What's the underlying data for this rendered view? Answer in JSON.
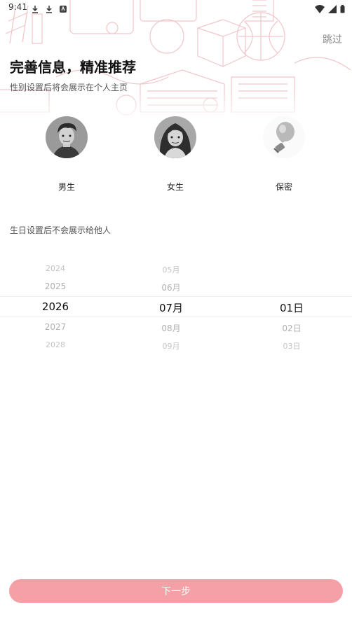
{
  "status_bar": {
    "time": "9:41"
  },
  "header": {
    "skip_label": "跳过",
    "title": "完善信息，精准推荐",
    "subtitle": "性别设置后将会展示在个人主页"
  },
  "gender": {
    "options": [
      {
        "label": "男生",
        "icon": "male-avatar"
      },
      {
        "label": "女生",
        "icon": "female-avatar"
      },
      {
        "label": "保密",
        "icon": "lightbulb-icon"
      }
    ]
  },
  "birthday": {
    "hint": "生日设置后不会展示给他人",
    "years": [
      "2024",
      "2025",
      "2026",
      "2027",
      "2028"
    ],
    "months": [
      "05月",
      "06月",
      "07月",
      "08月",
      "09月"
    ],
    "days": [
      "",
      "",
      "01日",
      "02日",
      "03日"
    ],
    "selected": {
      "year": "2026",
      "month": "07月",
      "day": "01日"
    }
  },
  "footer": {
    "next_label": "下一步"
  },
  "colors": {
    "accent": "#f5a0a6",
    "background_art": "#f4c9cc"
  }
}
